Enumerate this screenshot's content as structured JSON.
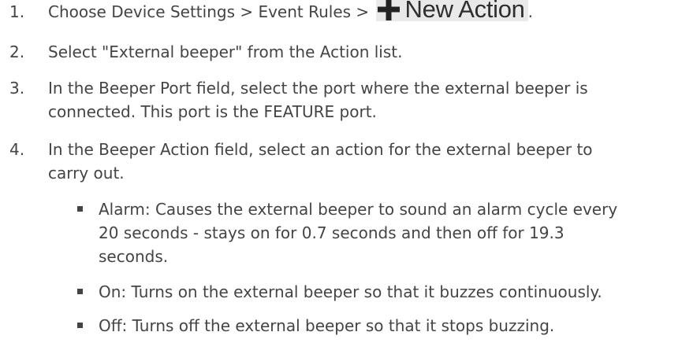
{
  "steps": [
    {
      "num": "1.",
      "prefix": "Choose Device Settings > Event Rules > ",
      "button_label": "New Action",
      "suffix": "."
    },
    {
      "num": "2.",
      "lines": [
        "Select \"External beeper\" from the Action list."
      ]
    },
    {
      "num": "3.",
      "lines": [
        "In the Beeper Port field, select the port where the external beeper is",
        "connected. This port is the FEATURE port."
      ]
    },
    {
      "num": "4.",
      "lines": [
        "In the Beeper Action field, select an action for the external beeper to",
        "carry out."
      ]
    }
  ],
  "bullets": [
    {
      "lines": [
        "Alarm: Causes the external beeper to sound an alarm cycle every",
        " 20 seconds - stays on for 0.7 seconds and then off for 19.3",
        " seconds."
      ]
    },
    {
      "lines": [
        "On: Turns on the external beeper so that it buzzes continuously."
      ]
    },
    {
      "lines": [
        "Off: Turns off the external beeper so that it stops buzzing."
      ]
    }
  ],
  "icons": {
    "new_action_icon": "plus-icon",
    "bullet_icon": "square-bullet-icon"
  },
  "colors": {
    "text": "#444444",
    "button_bg": "#e9e9e9",
    "button_text": "#2f2f2f"
  }
}
